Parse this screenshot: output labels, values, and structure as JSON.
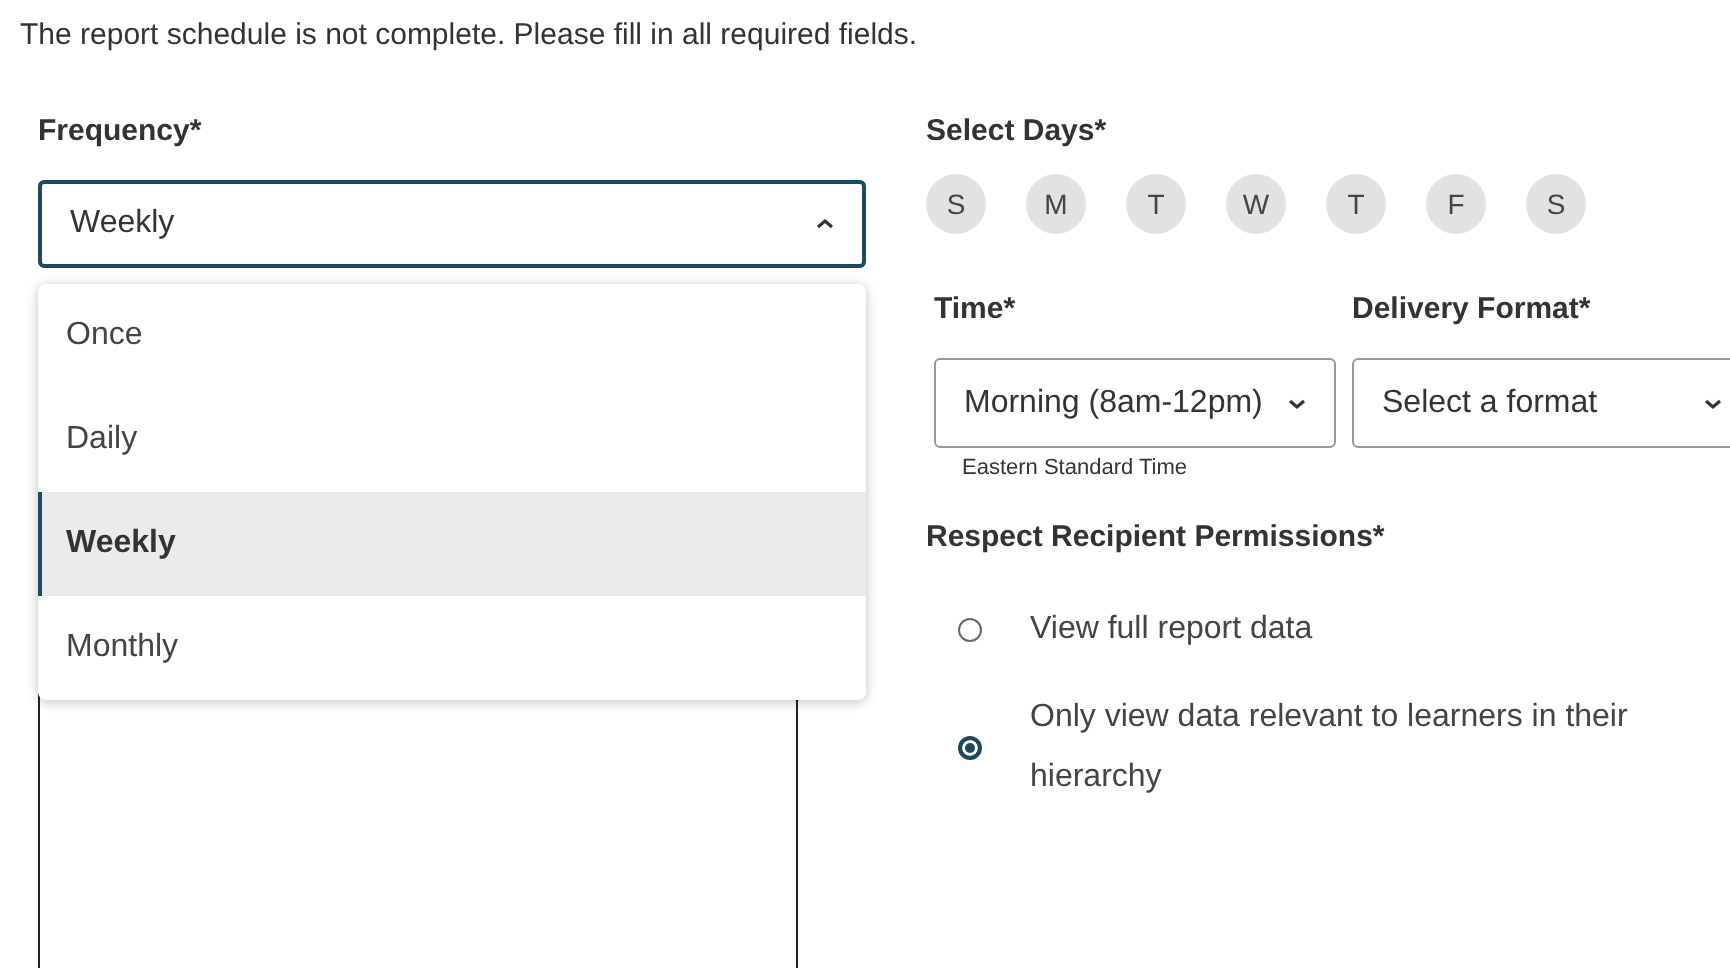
{
  "message": "The report schedule is not complete. Please fill in all required fields.",
  "frequency": {
    "label": "Frequency*",
    "value": "Weekly",
    "expanded": true,
    "options": [
      {
        "label": "Once",
        "selected": false
      },
      {
        "label": "Daily",
        "selected": false
      },
      {
        "label": "Weekly",
        "selected": true
      },
      {
        "label": "Monthly",
        "selected": false
      }
    ]
  },
  "select_days": {
    "label": "Select Days*",
    "days": [
      {
        "label": "S",
        "selected": false
      },
      {
        "label": "M",
        "selected": false
      },
      {
        "label": "T",
        "selected": false
      },
      {
        "label": "W",
        "selected": false
      },
      {
        "label": "T",
        "selected": false
      },
      {
        "label": "F",
        "selected": false
      },
      {
        "label": "S",
        "selected": false
      }
    ]
  },
  "time": {
    "label": "Time*",
    "value": "Morning (8am-12pm)",
    "hint": "Eastern Standard Time"
  },
  "delivery_format": {
    "label": "Delivery Format*",
    "placeholder": "Select a format"
  },
  "permissions": {
    "label": "Respect Recipient Permissions*",
    "options": [
      {
        "label": "View full report data",
        "selected": false
      },
      {
        "label": "Only view data relevant to learners in their hierarchy",
        "selected": true
      }
    ]
  }
}
